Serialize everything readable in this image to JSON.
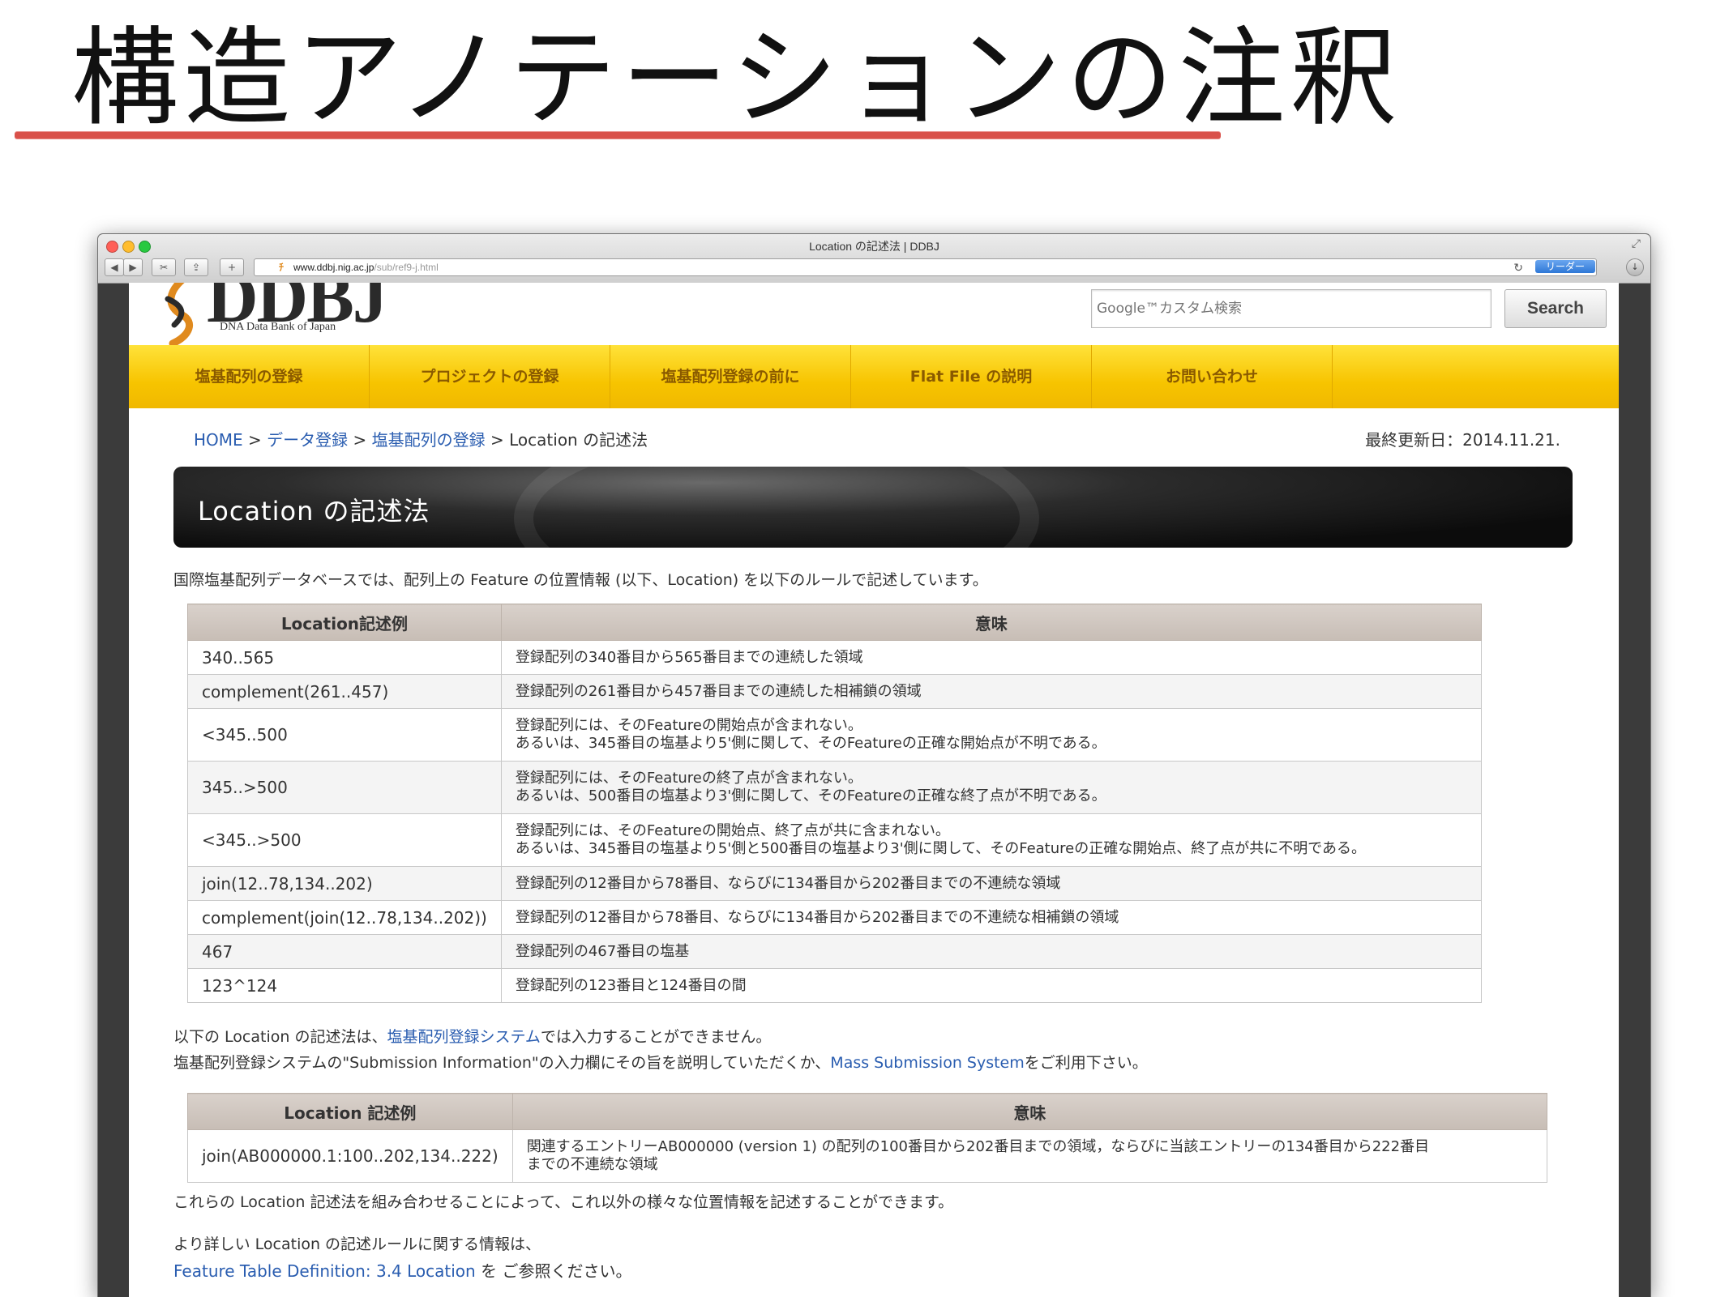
{
  "slide": {
    "title": "構造アノテーションの注釈"
  },
  "browser": {
    "window_title": "Location の記述法 | DDBJ",
    "url_host": "www.ddbj.nig.ac.jp",
    "url_path": "/sub/ref9-j.html",
    "reader_label": "リーダー",
    "back_icon": "◀",
    "forward_icon": "▶"
  },
  "header": {
    "logo_text": "DDBJ",
    "logo_subtitle": "DNA Data Bank of Japan",
    "search_placeholder": "Google™カスタム検索",
    "search_button": "Search"
  },
  "nav": {
    "items": [
      {
        "label": "塩基配列の登録"
      },
      {
        "label": "プロジェクトの登録"
      },
      {
        "label": "塩基配列登録の前に"
      },
      {
        "label": "Flat File の説明"
      },
      {
        "label": "お問い合わせ"
      }
    ]
  },
  "breadcrumb": {
    "home": "HOME",
    "sep": ">",
    "data_reg": "データ登録",
    "seq_reg": "塩基配列の登録",
    "current": "Location の記述法"
  },
  "updated": "最終更新日：2014.11.21.",
  "banner_title": "Location の記述法",
  "intro": "国際塩基配列データベースでは、配列上の Feature の位置情報 (以下、Location) を以下のルールで記述しています。",
  "table1": {
    "headers": [
      "Location記述例",
      "意味"
    ],
    "rows": [
      {
        "loc": "340..565",
        "desc": [
          "登録配列の340番目から565番目までの連続した領域"
        ]
      },
      {
        "loc": "complement(261..457)",
        "desc": [
          "登録配列の261番目から457番目までの連続した相補鎖の領域"
        ]
      },
      {
        "loc": "<345..500",
        "desc": [
          "登録配列には、そのFeatureの開始点が含まれない。",
          "あるいは、345番目の塩基より5'側に関して、そのFeatureの正確な開始点が不明である。"
        ]
      },
      {
        "loc": "345..>500",
        "desc": [
          "登録配列には、そのFeatureの終了点が含まれない。",
          "あるいは、500番目の塩基より3'側に関して、そのFeatureの正確な終了点が不明である。"
        ]
      },
      {
        "loc": "<345..>500",
        "desc": [
          "登録配列には、そのFeatureの開始点、終了点が共に含まれない。",
          "あるいは、345番目の塩基より5'側と500番目の塩基より3'側に関して、そのFeatureの正確な開始点、終了点が共に不明である。"
        ]
      },
      {
        "loc": "join(12..78,134..202)",
        "desc": [
          "登録配列の12番目から78番目、ならびに134番目から202番目までの不連続な領域"
        ]
      },
      {
        "loc": "complement(join(12..78,134..202))",
        "desc": [
          "登録配列の12番目から78番目、ならびに134番目から202番目までの不連続な相補鎖の領域"
        ]
      },
      {
        "loc": "467",
        "desc": [
          "登録配列の467番目の塩基"
        ]
      },
      {
        "loc": "123^124",
        "desc": [
          "登録配列の123番目と124番目の間"
        ]
      }
    ]
  },
  "note": {
    "line1_pre": "以下の Location の記述法は、",
    "line1_link": "塩基配列登録システム",
    "line1_post": "では入力することができません。",
    "line2_pre": "塩基配列登録システムの\"Submission Information\"の入力欄にその旨を説明していただくか、",
    "line2_link": "Mass Submission System",
    "line2_post": "をご利用下さい。"
  },
  "table2": {
    "headers": [
      "Location 記述例",
      "意味"
    ],
    "rows": [
      {
        "loc": "join(AB000000.1:100..202,134..222)",
        "desc": [
          "関連するエントリーAB000000 (version 1) の配列の100番目から202番目までの領域，ならびに当該エントリーの134番目から222番目",
          "までの不連続な領域"
        ]
      }
    ]
  },
  "combine_text": "これらの Location 記述法を組み合わせることによって、これ以外の様々な位置情報を記述することができます。",
  "more": {
    "line1": "より詳しい Location の記述ルールに関する情報は、",
    "link1": "Feature Table Definition",
    "colon": ": ",
    "link2": "3.4 Location",
    "post": " を ご参照ください。"
  }
}
